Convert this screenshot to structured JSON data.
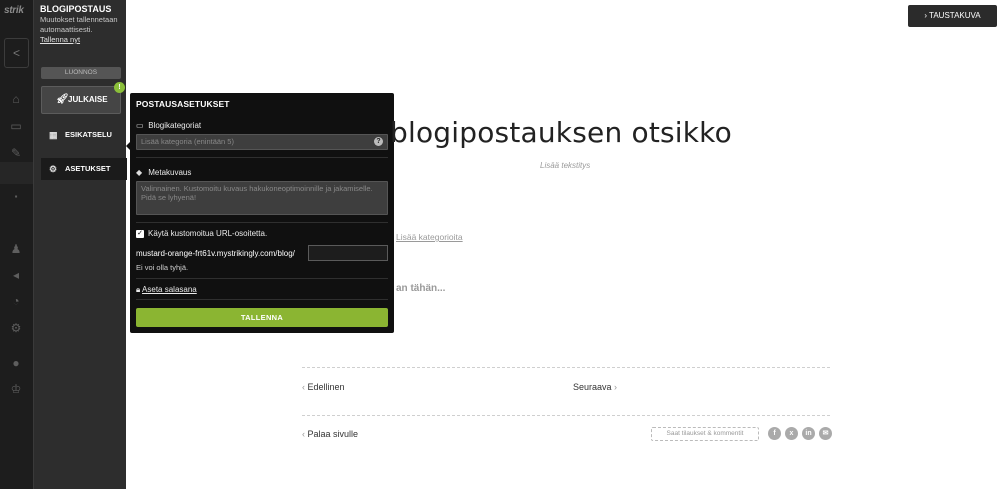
{
  "leftnav": {
    "logo": "strik",
    "back_glyph": "<",
    "icons": [
      "home-icon",
      "store-icon",
      "edit-icon",
      "blog-icon",
      "users-icon",
      "marketing-icon",
      "analytics-icon",
      "settings-icon",
      "chat-icon",
      "trophy-icon"
    ]
  },
  "panel": {
    "title": "BLOGIPOSTAUS",
    "autosave_note": "Muutokset tallennetaan automaattisesti.",
    "save_now": "Tallenna nyt",
    "draft_label": "LUONNOS",
    "publish_label": "JULKAISE",
    "publish_badge": "!",
    "preview_label": "ESIKATSELU",
    "settings_label": "ASETUKSET"
  },
  "popup": {
    "title": "POSTAUSASETUKSET",
    "category_label": "Blogikategoriat",
    "category_placeholder": "Lisää kategoria (enintään 5)",
    "help_glyph": "?",
    "meta_label": "Metakuvaus",
    "meta_placeholder": "Valinnainen. Kustomoitu kuvaus hakukoneoptimoinnille ja jakamiselle. Pidä se lyhyenä!",
    "custom_url_label": "Käytä kustomoitua URL-osoitetta.",
    "custom_url_checked": true,
    "url_prefix": "mustard-orange-frt61v.mystrikingly.com/blog/",
    "url_value": "",
    "error_text": "Ei voi olla tyhjä.",
    "password_label": "Aseta salasana",
    "save_label": "TALLENNA"
  },
  "page": {
    "background_button": "TAUSTAKUVA",
    "post_title": "blogipostauksen otsikko",
    "subtitle_placeholder": "Lisää tekstitys",
    "add_categories": "Lisää kategorioita",
    "body_placeholder": "an tähän...",
    "prev_label": "Edellinen",
    "next_label": "Seuraava",
    "back_label": "Palaa sivulle",
    "subscribe_label": "Saat tilaukset & kommentit",
    "social_icons": [
      "facebook-icon",
      "x-icon",
      "linkedin-icon",
      "email-icon"
    ]
  },
  "colors": {
    "accent_green": "#8bb532",
    "popup_bg": "#101010",
    "panel_bg": "#2d2d2d"
  }
}
